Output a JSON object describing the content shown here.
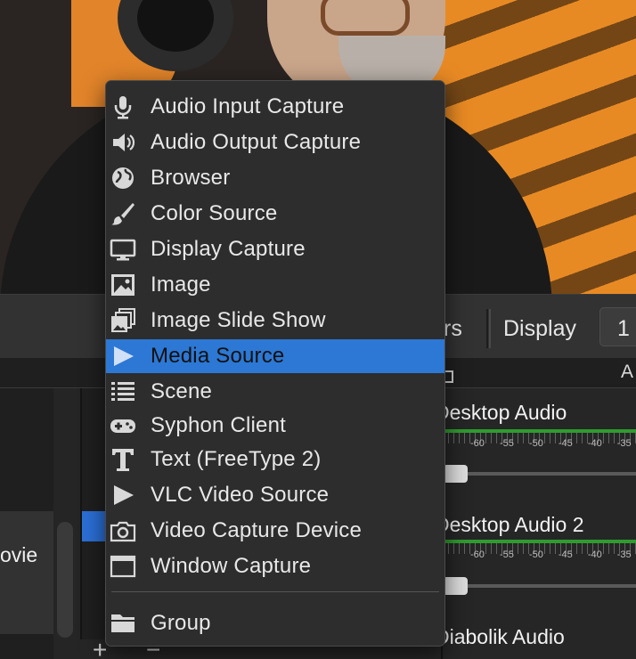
{
  "dock": {
    "tab_filters": "rs",
    "tab_display": "Display",
    "zoom_value": "1"
  },
  "mixer": {
    "header_label": "A",
    "channels": [
      {
        "name": "Desktop Audio",
        "scale": "-60 -55 -50 -45 -40 -35"
      },
      {
        "name": "Desktop Audio 2",
        "scale": "-60 -55 -50 -45 -40 -35"
      },
      {
        "name": "Diabolik Audio"
      }
    ]
  },
  "scenes": {
    "selected_text": "ovie"
  },
  "menu": {
    "items": [
      {
        "label": "Audio Input Capture",
        "icon": "microphone-icon"
      },
      {
        "label": "Audio Output Capture",
        "icon": "speaker-icon"
      },
      {
        "label": "Browser",
        "icon": "globe-icon"
      },
      {
        "label": "Color Source",
        "icon": "brush-icon"
      },
      {
        "label": "Display Capture",
        "icon": "monitor-icon"
      },
      {
        "label": "Image",
        "icon": "image-icon"
      },
      {
        "label": "Image Slide Show",
        "icon": "slideshow-icon"
      },
      {
        "label": "Media Source",
        "icon": "play-icon",
        "selected": true
      },
      {
        "label": "Scene",
        "icon": "list-icon"
      },
      {
        "label": "Syphon Client",
        "icon": "gamepad-icon"
      },
      {
        "label": "Text (FreeType 2)",
        "icon": "text-icon"
      },
      {
        "label": "VLC Video Source",
        "icon": "play-icon"
      },
      {
        "label": "Video Capture Device",
        "icon": "camera-icon"
      },
      {
        "label": "Window Capture",
        "icon": "window-icon"
      },
      {
        "label": "Group",
        "icon": "folder-icon"
      }
    ]
  },
  "colors": {
    "selection": "#2c78d4",
    "menu_bg": "#2d2d2d",
    "meter_green": "#2f9c2f"
  }
}
